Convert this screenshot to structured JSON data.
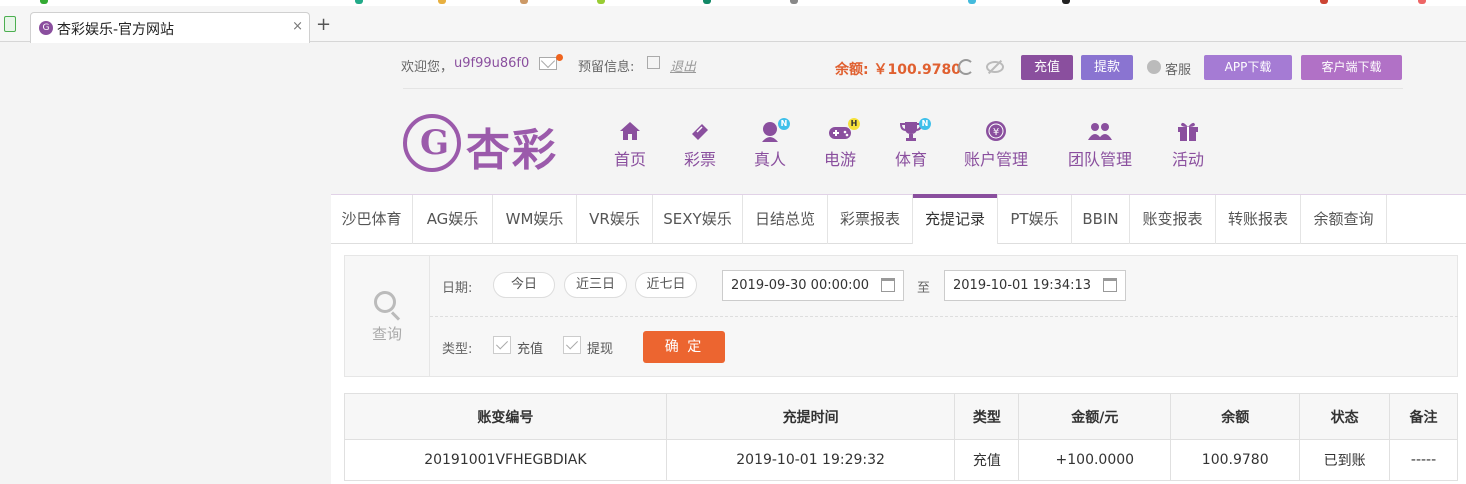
{
  "browser": {
    "tab_title": "杏彩娱乐-官方网站",
    "tab_favicon": "G",
    "close": "×",
    "new_tab": "+"
  },
  "topbar": {
    "welcome": "欢迎您，",
    "username": "u9f99u86f0",
    "reserve_label": "预留信息:",
    "logout": "退出",
    "balance": "余额: ￥100.9780",
    "recharge": "充值",
    "withdraw": "提款",
    "service": "客服",
    "app_download": "APP下载",
    "client_download": "客户端下载"
  },
  "logo": {
    "text": "杏彩"
  },
  "nav": [
    {
      "label": "首页",
      "icon": "home-icon",
      "badge": ""
    },
    {
      "label": "彩票",
      "icon": "ticket-icon",
      "badge": ""
    },
    {
      "label": "真人",
      "icon": "dealer-icon",
      "badge": "N"
    },
    {
      "label": "电游",
      "icon": "gamepad-icon",
      "badge": "H"
    },
    {
      "label": "体育",
      "icon": "trophy-icon",
      "badge": "N"
    },
    {
      "label": "账户管理",
      "icon": "yen-coin-icon",
      "badge": ""
    },
    {
      "label": "团队管理",
      "icon": "team-icon",
      "badge": ""
    },
    {
      "label": "活动",
      "icon": "gift-icon",
      "badge": ""
    }
  ],
  "subtabs": [
    "沙巴体育",
    "AG娱乐",
    "WM娱乐",
    "VR娱乐",
    "SEXY娱乐",
    "日结总览",
    "彩票报表",
    "充提记录",
    "PT娱乐",
    "BBIN",
    "账变报表",
    "转账报表",
    "余额查询"
  ],
  "active_subtab": "充提记录",
  "query": {
    "side_label": "查询",
    "date_label": "日期:",
    "today": "今日",
    "three_days": "近三日",
    "seven_days": "近七日",
    "start": "2019-09-30 00:00:00",
    "to": "至",
    "end": "2019-10-01 19:34:13",
    "type_label": "类型:",
    "type_recharge": "充值",
    "type_withdraw": "提现",
    "confirm": "确 定"
  },
  "table": {
    "headers": [
      "账变编号",
      "充提时间",
      "类型",
      "金额/元",
      "余额",
      "状态",
      "备注"
    ],
    "rows": [
      [
        "20191001VFHEGBDIAK",
        "2019-10-01 19:29:32",
        "充值",
        "+100.0000",
        "100.9780",
        "已到账",
        "-----"
      ]
    ]
  }
}
